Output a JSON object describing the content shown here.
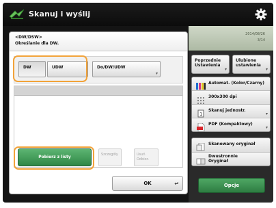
{
  "header": {
    "title": "Skanuj i wyślij"
  },
  "status": {
    "line1": "2014/08/26",
    "line2": "3/14"
  },
  "dialog": {
    "title_line1": "<DW/DSW>",
    "title_line2": "Określanie dla DW.",
    "recipient_buttons": [
      {
        "label": "DW"
      },
      {
        "label": "UDW"
      },
      {
        "label": "Do/DW/UDW"
      }
    ],
    "address_book_button": "Pobierz z listy",
    "details_button": "Szczegóły",
    "delete_button_line1": "Usuń",
    "delete_button_line2": "Odbior.",
    "ok_button": "OK"
  },
  "right_panel": {
    "top_buttons": [
      {
        "line1": "Poprzednie",
        "line2": "Ustawienia"
      },
      {
        "line1": "Ulubione",
        "line2": "ustawienia"
      }
    ],
    "options": [
      {
        "label": "Automat. (Kolor/Czarny)"
      },
      {
        "label": "300x300 dpi"
      },
      {
        "label": "Skanuj jednostr."
      },
      {
        "label": "PDF (Kompaktowy)"
      }
    ],
    "options2": [
      {
        "label": "Skanowany oryginał"
      },
      {
        "label": "Dwustronnie",
        "line2": "Oryginał"
      }
    ],
    "options_button": "Opcje"
  },
  "colors": {
    "accent_green": "#2f8746",
    "highlight": "#f2a33a"
  }
}
